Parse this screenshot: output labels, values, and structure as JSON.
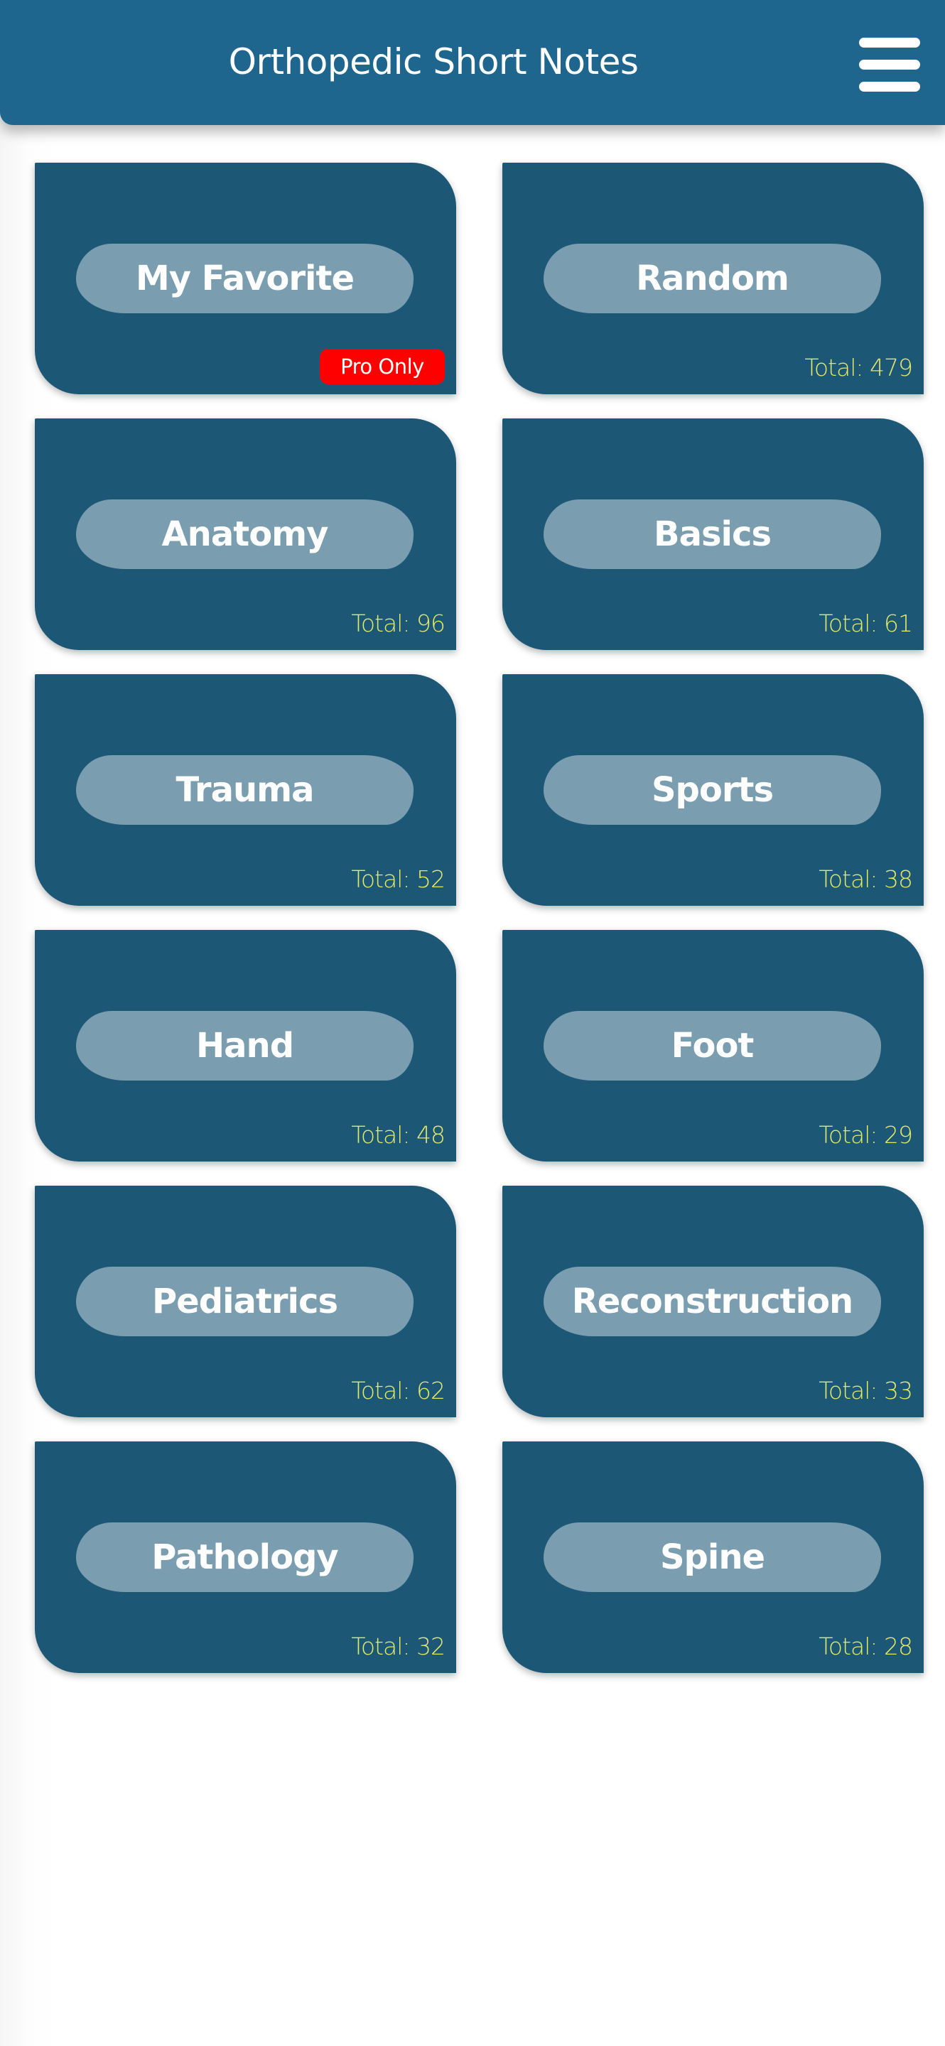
{
  "app_bar": {
    "title": "Orthopedic Short Notes",
    "menu_icon": "hamburger-menu-icon",
    "background_color": "#1e668d"
  },
  "colors": {
    "card_background": "#1c5876",
    "pill_background": "#7a9daf",
    "total_text": "#e2e86a",
    "pro_badge": "#ff0000"
  },
  "categories": [
    {
      "label": "My Favorite",
      "badge": "Pro Only"
    },
    {
      "label": "Random",
      "total": "Total: 479"
    },
    {
      "label": "Anatomy",
      "total": "Total: 96"
    },
    {
      "label": "Basics",
      "total": "Total: 61"
    },
    {
      "label": "Trauma",
      "total": "Total: 52"
    },
    {
      "label": "Sports",
      "total": "Total: 38"
    },
    {
      "label": "Hand",
      "total": "Total: 48"
    },
    {
      "label": "Foot",
      "total": "Total: 29"
    },
    {
      "label": "Pediatrics",
      "total": "Total: 62"
    },
    {
      "label": "Reconstruction",
      "total": "Total: 33"
    },
    {
      "label": "Pathology",
      "total": "Total: 32"
    },
    {
      "label": "Spine",
      "total": "Total: 28"
    }
  ]
}
